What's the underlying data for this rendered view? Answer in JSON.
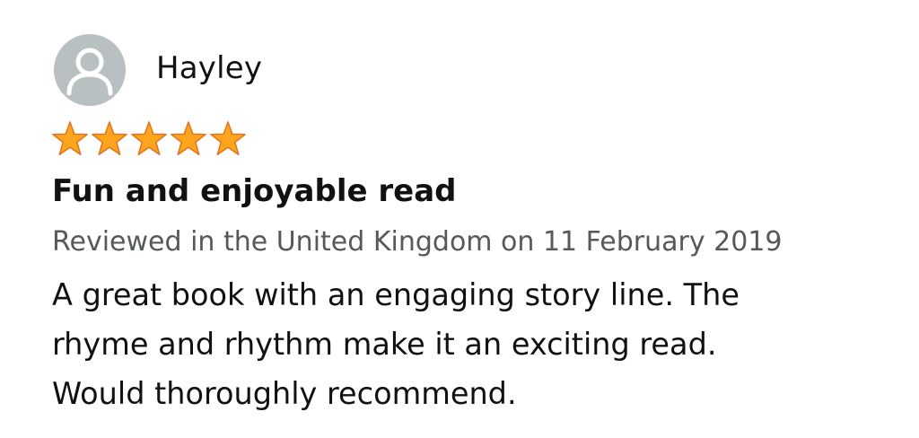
{
  "review": {
    "reviewer_name": "Hayley",
    "rating": 5,
    "rating_max": 5,
    "title": "Fun and enjoyable read",
    "meta": "Reviewed in the United Kingdom on 11 February 2019",
    "body_lines": [
      "A great book with an engaging story line. The",
      "rhyme and rhythm make it an exciting read.",
      "Would thoroughly recommend."
    ]
  },
  "icons": {
    "avatar": "person-icon",
    "star": "star-icon"
  },
  "colors": {
    "star_fill": "#ffa41c",
    "star_stroke": "#de7921",
    "avatar_bg": "#b8c0c2",
    "meta_text": "#565959",
    "text": "#111111"
  }
}
